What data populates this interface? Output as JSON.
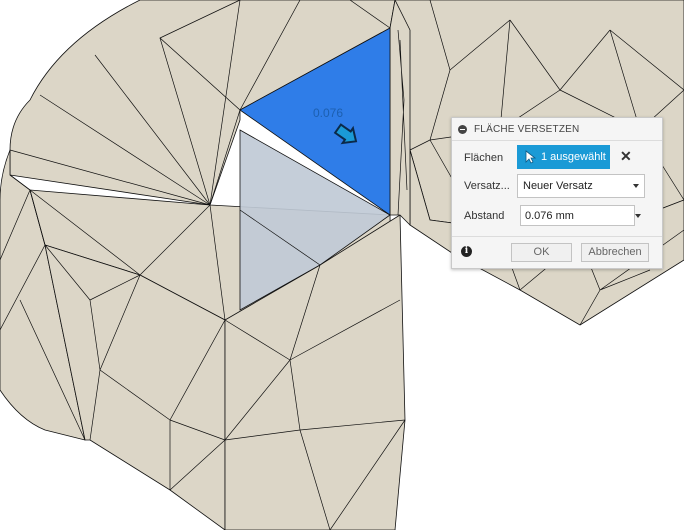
{
  "viewport": {
    "dimension_value": "0.076",
    "colors": {
      "body": "#dcd6c7",
      "selected_face": "#2f7de8",
      "preview_face": "#c0cad6",
      "edge": "#111111"
    }
  },
  "dialog": {
    "title": "FLÄCHE VERSETZEN",
    "faces_label": "Flächen",
    "faces_selection": "1 ausgewählt",
    "offset_type_label": "Versatz...",
    "offset_type_value": "Neuer Versatz",
    "distance_label": "Abstand",
    "distance_value": "0.076 mm",
    "ok_label": "OK",
    "cancel_label": "Abbrechen",
    "accent_color": "#1a9ad6"
  }
}
